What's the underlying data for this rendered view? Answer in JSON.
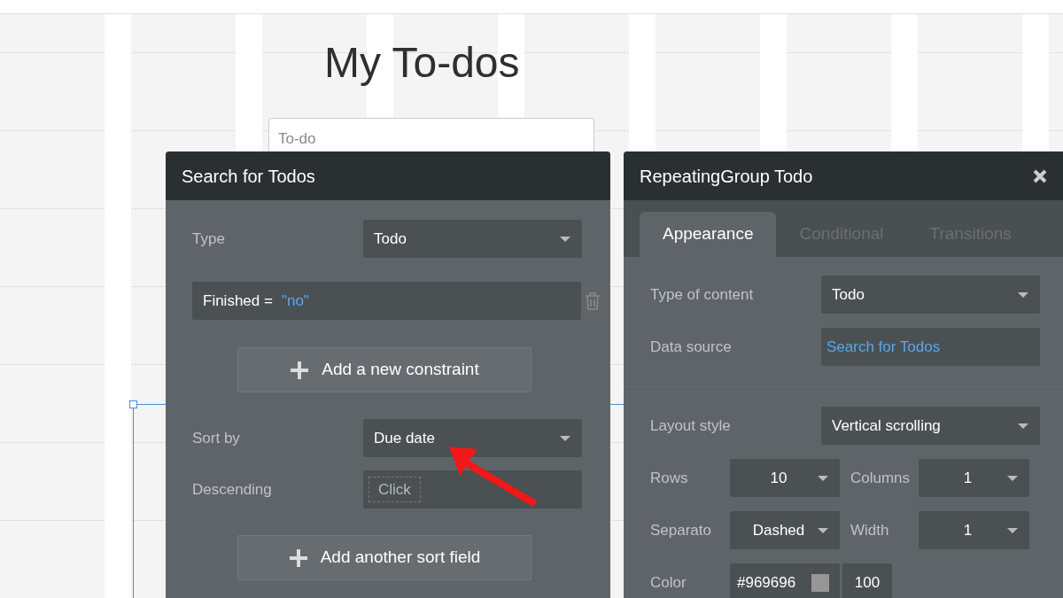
{
  "page_title": "My To-dos",
  "todo_input": {
    "placeholder": "To-do"
  },
  "search_panel": {
    "title": "Search for Todos",
    "type": {
      "label": "Type",
      "value": "Todo"
    },
    "constraints": [
      {
        "field": "Finished =",
        "value": "\"no\""
      }
    ],
    "add_constraint": "Add a new constraint",
    "sort_by": {
      "label": "Sort by",
      "value": "Due date"
    },
    "descending": {
      "label": "Descending",
      "value": "Click"
    },
    "add_sort": "Add another sort field"
  },
  "group_panel": {
    "title": "RepeatingGroup Todo",
    "tabs": [
      {
        "label": "Appearance",
        "selected": true
      },
      {
        "label": "Conditional",
        "selected": false
      },
      {
        "label": "Transitions",
        "selected": false
      }
    ],
    "type_of_content": {
      "label": "Type of content",
      "value": "Todo"
    },
    "data_source": {
      "label": "Data source",
      "value": "Search for Todos"
    },
    "layout_style": {
      "label": "Layout style",
      "value": "Vertical scrolling"
    },
    "rows": {
      "label": "Rows",
      "value": "10"
    },
    "columns": {
      "label": "Columns",
      "value": "1"
    },
    "separator": {
      "label": "Separato",
      "value": "Dashed"
    },
    "width": {
      "label": "Width",
      "value": "1"
    },
    "color": {
      "label": "Color",
      "hex": "#969696",
      "color": "#969696",
      "opacity": "100"
    }
  }
}
